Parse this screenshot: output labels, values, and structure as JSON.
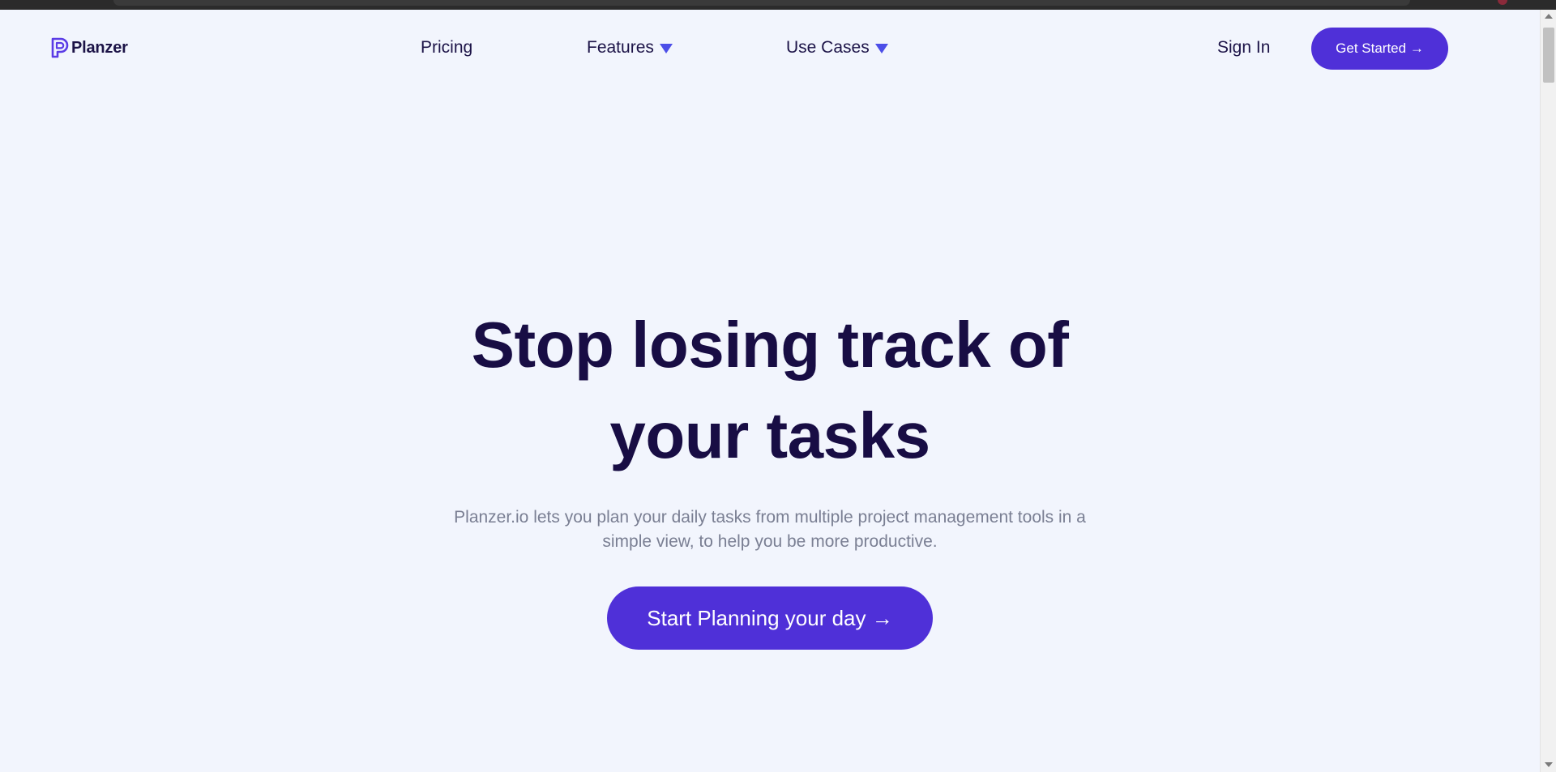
{
  "brand": {
    "name": "Planzer",
    "logo_icon": "planzer-logo-icon",
    "accent_color": "#4f30d8",
    "caret_color": "#4c4ee8"
  },
  "nav": {
    "pricing": "Pricing",
    "features": "Features",
    "use_cases": "Use Cases",
    "sign_in": "Sign In",
    "get_started": "Get Started →"
  },
  "hero": {
    "title": "Stop losing track of your tasks",
    "subtitle": "Planzer.io lets you plan your daily tasks from multiple project management tools in a simple view, to help you be more productive.",
    "cta": "Start Planning your day →"
  }
}
